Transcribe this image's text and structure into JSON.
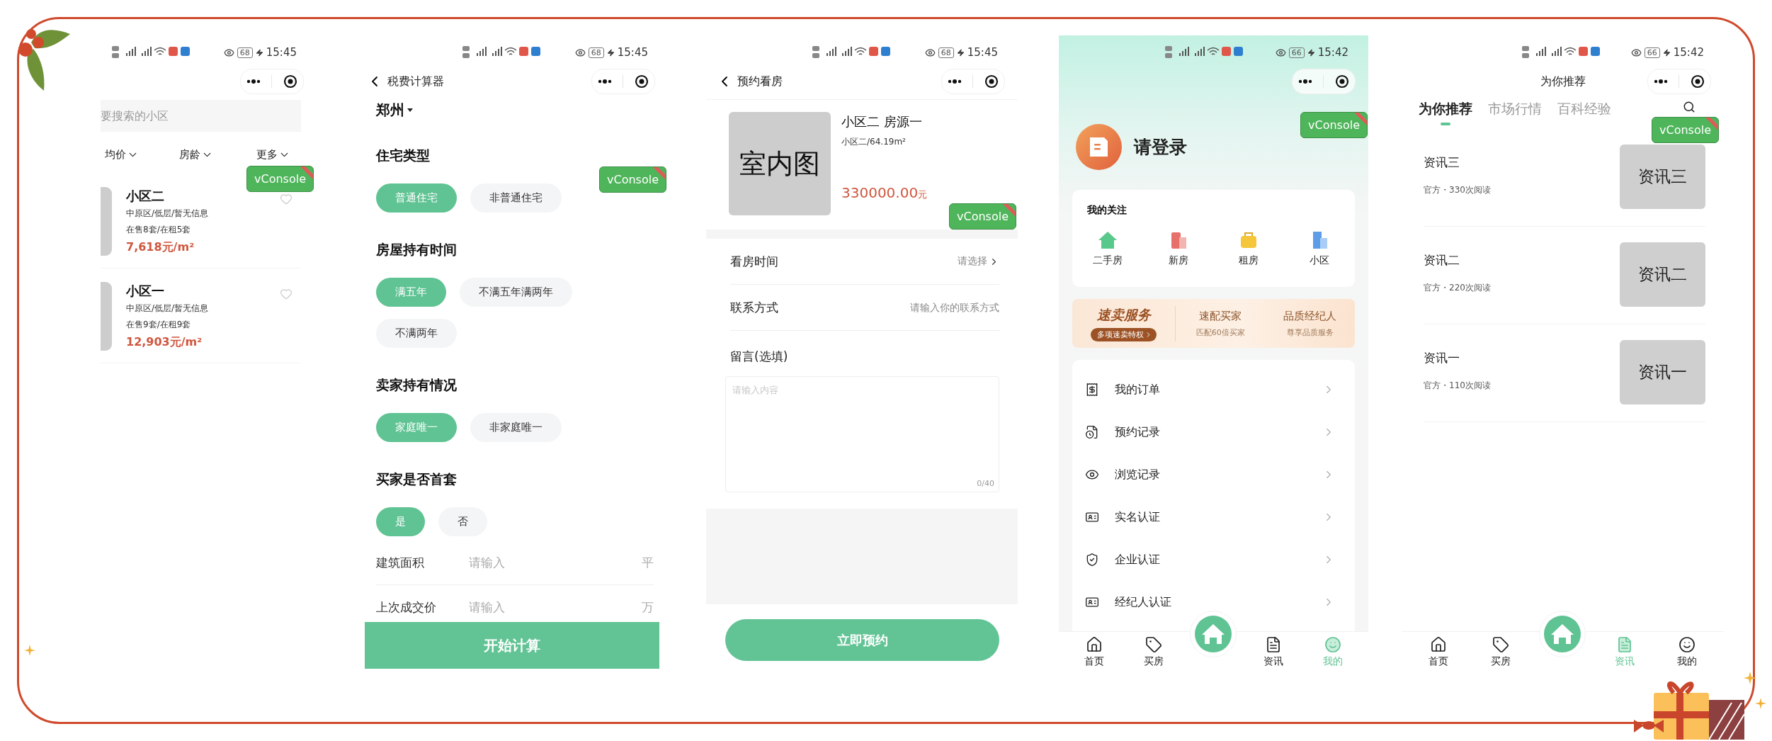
{
  "community_list": {
    "status_bar": {
      "battery": "68",
      "time": "15:45"
    },
    "search": {
      "placeholder": "要搜索的小区"
    },
    "filters": [
      {
        "label": "均价"
      },
      {
        "label": "房龄"
      },
      {
        "label": "更多"
      }
    ],
    "communities": [
      {
        "name": "小区二",
        "info": "中原区/低层/暂无信息",
        "stock": "在售8套/在租5套",
        "price": "7,618元/m²"
      },
      {
        "name": "小区一",
        "info": "中原区/低层/暂无信息",
        "stock": "在售9套/在租9套",
        "price": "12,903元/m²"
      }
    ],
    "vconsole": "vConsole"
  },
  "tax_calculator": {
    "status_bar": {
      "battery": "68",
      "time": "15:45"
    },
    "title": "税费计算器",
    "city": "郑州",
    "sections": [
      {
        "title": "住宅类型",
        "options": [
          {
            "label": "普通住宅",
            "selected": true
          },
          {
            "label": "非普通住宅",
            "selected": false
          }
        ]
      },
      {
        "title": "房屋持有时间",
        "options": [
          {
            "label": "满五年",
            "selected": true
          },
          {
            "label": "不满五年满两年",
            "selected": false
          },
          {
            "label": "不满两年",
            "selected": false
          }
        ]
      },
      {
        "title": "卖家持有情况",
        "options": [
          {
            "label": "家庭唯一",
            "selected": true
          },
          {
            "label": "非家庭唯一",
            "selected": false
          }
        ]
      },
      {
        "title": "买家是否首套",
        "options": [
          {
            "label": "是",
            "selected": true
          },
          {
            "label": "否",
            "selected": false
          }
        ]
      }
    ],
    "fields": [
      {
        "label": "建筑面积",
        "placeholder": "请输入",
        "unit": "平"
      },
      {
        "label": "上次成交价",
        "placeholder": "请输入",
        "unit": "万"
      }
    ],
    "submit": "开始计算",
    "vconsole": "vConsole"
  },
  "viewing_booking": {
    "status_bar": {
      "battery": "68",
      "time": "15:45"
    },
    "title": "预约看房",
    "listing": {
      "image_label": "室内图",
      "title": "小区二 房源一",
      "subtitle": "小区二/64.19m²",
      "price": "330000.00",
      "unit": "元"
    },
    "rows": [
      {
        "kind": "select",
        "label": "看房时间",
        "value": "请选择"
      },
      {
        "kind": "input",
        "label": "联系方式",
        "placeholder": "请输入你的联系方式"
      }
    ],
    "message": {
      "label": "留言(选填)",
      "placeholder": "请输入内容",
      "counter": "0/40"
    },
    "submit": "立即预约",
    "vconsole": "vConsole"
  },
  "profile": {
    "status_bar": {
      "battery": "66",
      "time": "15:42"
    },
    "login": "请登录",
    "follows": {
      "title": "我的关注",
      "items": [
        {
          "label": "二手房"
        },
        {
          "label": "新房"
        },
        {
          "label": "租房"
        },
        {
          "label": "小区"
        }
      ]
    },
    "banner": {
      "title": "速卖服务",
      "pill": "多项速卖特权",
      "features": [
        {
          "title": "速配买家",
          "subtitle": "匹配60倍买家"
        },
        {
          "title": "品质经纪人",
          "subtitle": "尊享品质服务"
        }
      ]
    },
    "menu": [
      {
        "label": "我的订单"
      },
      {
        "label": "预约记录"
      },
      {
        "label": "浏览记录"
      },
      {
        "label": "实名认证"
      },
      {
        "label": "企业认证"
      },
      {
        "label": "经纪人认证"
      }
    ],
    "tab_bar": [
      {
        "label": "首页",
        "selected": false
      },
      {
        "label": "买房",
        "selected": false
      },
      {
        "label": "资讯",
        "selected": false
      },
      {
        "label": "我的",
        "selected": true
      }
    ],
    "vconsole": "vConsole"
  },
  "news": {
    "status_bar": {
      "battery": "66",
      "time": "15:42"
    },
    "title": "为你推荐",
    "tabs": [
      {
        "label": "为你推荐",
        "selected": true
      },
      {
        "label": "市场行情",
        "selected": false
      },
      {
        "label": "百科经验",
        "selected": false
      }
    ],
    "articles": [
      {
        "title": "资讯三",
        "meta": "官方・330次阅读",
        "image_label": "资讯三"
      },
      {
        "title": "资讯二",
        "meta": "官方・220次阅读",
        "image_label": "资讯二"
      },
      {
        "title": "资讯一",
        "meta": "官方・110次阅读",
        "image_label": "资讯一"
      }
    ],
    "tab_bar": [
      {
        "label": "首页",
        "selected": false
      },
      {
        "label": "买房",
        "selected": false
      },
      {
        "label": "资讯",
        "selected": true
      },
      {
        "label": "我的",
        "selected": false
      }
    ],
    "vconsole": "vConsole"
  }
}
